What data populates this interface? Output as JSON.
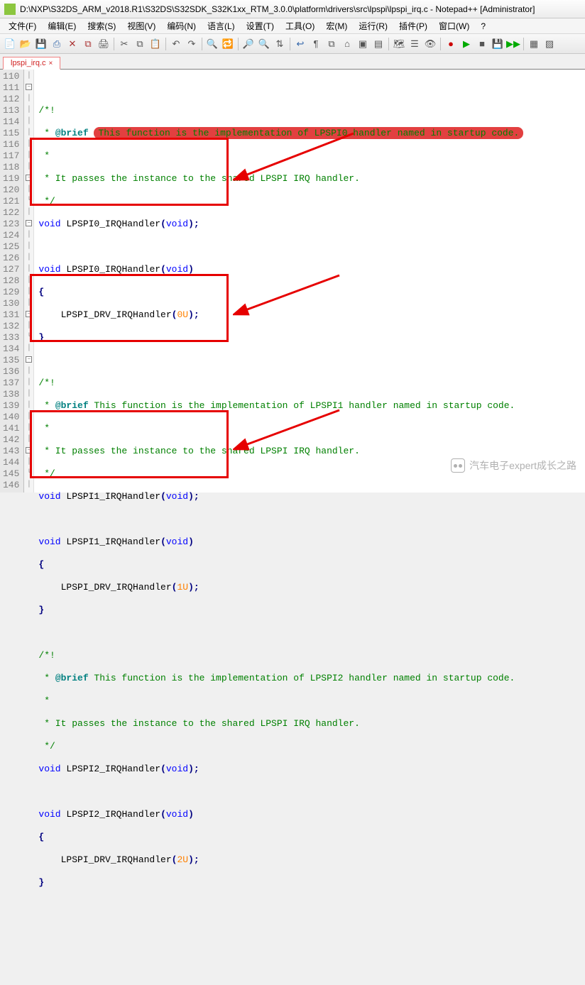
{
  "titlebar": {
    "path": "D:\\NXP\\S32DS_ARM_v2018.R1\\S32DS\\S32SDK_S32K1xx_RTM_3.0.0\\platform\\drivers\\src\\lpspi\\lpspi_irq.c - Notepad++ [Administrator]"
  },
  "menu": {
    "items": [
      "文件(F)",
      "编辑(E)",
      "搜索(S)",
      "视图(V)",
      "编码(N)",
      "语言(L)",
      "设置(T)",
      "工具(O)",
      "宏(M)",
      "运行(R)",
      "插件(P)",
      "窗口(W)",
      "?"
    ]
  },
  "toolbar": {
    "icons": [
      "new-file",
      "open-file",
      "save",
      "save-all",
      "close",
      "close-all",
      "print",
      "cut",
      "copy",
      "paste",
      "undo",
      "redo",
      "find",
      "replace",
      "zoom-in",
      "zoom-out",
      "sync",
      "word-wrap",
      "show-all",
      "indent-guide",
      "lang",
      "fold",
      "unfold",
      "doc-map",
      "func-list",
      "monitor",
      "record",
      "play",
      "stop",
      "macro"
    ]
  },
  "tab": {
    "label": "lpspi_irq.c",
    "close": "×"
  },
  "lines": {
    "start": 110,
    "end": 146
  },
  "code": {
    "l111": "/*!",
    "l112a": " * ",
    "l112b": "@brief",
    "l112c": "This function is the implementation of LPSPI0 handler named in startup code.",
    "l113": " *",
    "l114": " * It passes the instance to the shared LPSPI IRQ handler.",
    "l115": " */",
    "l116a": "void",
    "l116b": " LPSPI0_IRQHandler",
    "l116c": "(",
    "l116d": "void",
    "l116e": ");",
    "l118a": "void",
    "l118b": " LPSPI0_IRQHandler",
    "l118c": "(",
    "l118d": "void",
    "l118e": ")",
    "l119": "{",
    "l120a": "    LPSPI_DRV_IRQHandler",
    "l120b": "(",
    "l120c": "0U",
    "l120d": ");",
    "l121": "}",
    "l123": "/*!",
    "l124a": " * ",
    "l124b": "@brief",
    "l124c": " This function is the implementation of LPSPI1 handler named in startup code.",
    "l125": " *",
    "l126": " * It passes the instance to the shared LPSPI IRQ handler.",
    "l127": " */",
    "l128a": "void",
    "l128b": " LPSPI1_IRQHandler",
    "l128c": "(",
    "l128d": "void",
    "l128e": ");",
    "l130a": "void",
    "l130b": " LPSPI1_IRQHandler",
    "l130c": "(",
    "l130d": "void",
    "l130e": ")",
    "l131": "{",
    "l132a": "    LPSPI_DRV_IRQHandler",
    "l132b": "(",
    "l132c": "1U",
    "l132d": ");",
    "l133": "}",
    "l135": "/*!",
    "l136a": " * ",
    "l136b": "@brief",
    "l136c": " This function is the implementation of LPSPI2 handler named in startup code.",
    "l137": " *",
    "l138": " * It passes the instance to the shared LPSPI IRQ handler.",
    "l139": " */",
    "l140a": "void",
    "l140b": " LPSPI2_IRQHandler",
    "l140c": "(",
    "l140d": "void",
    "l140e": ");",
    "l142a": "void",
    "l142b": " LPSPI2_IRQHandler",
    "l142c": "(",
    "l142d": "void",
    "l142e": ")",
    "l143": "{",
    "l144a": "    LPSPI_DRV_IRQHandler",
    "l144b": "(",
    "l144c": "2U",
    "l144d": ");",
    "l145": "}"
  },
  "watermark": {
    "text": "汽车电子expert成长之路"
  }
}
